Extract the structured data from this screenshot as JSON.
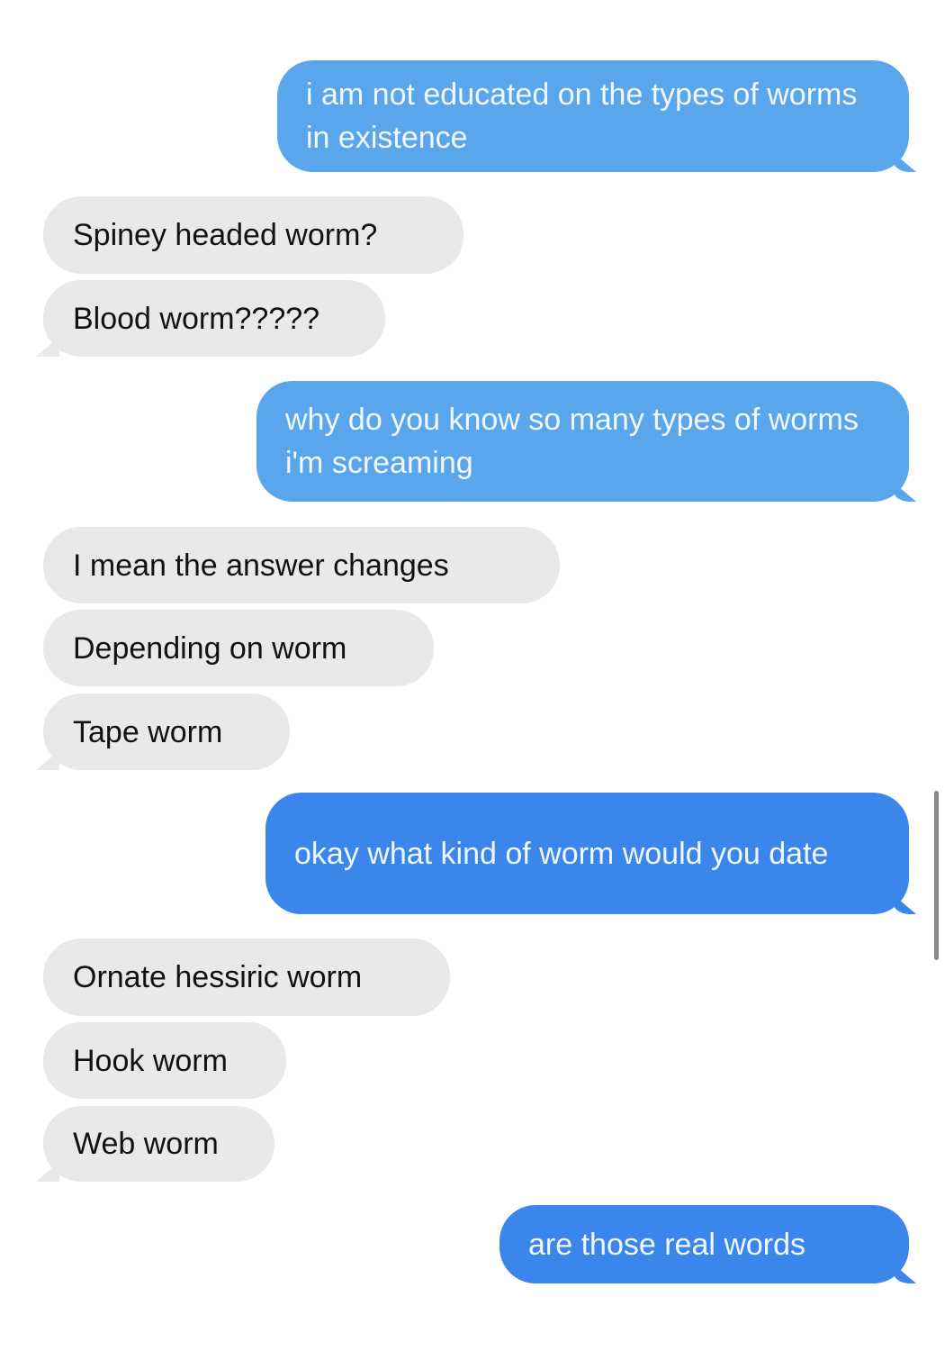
{
  "colors": {
    "sent_light": "#5aa6ec",
    "sent_dark": "#3a86ea",
    "received": "#e9e9eb"
  },
  "messages": [
    {
      "from": "me",
      "text": "i am not educated on the types of worms in existence"
    },
    {
      "from": "them",
      "text": "Spiney headed worm?"
    },
    {
      "from": "them",
      "text": "Blood worm?????"
    },
    {
      "from": "me",
      "text": "why do you know so many types of worms i'm screaming"
    },
    {
      "from": "them",
      "text": "I mean the answer changes"
    },
    {
      "from": "them",
      "text": "Depending on worm"
    },
    {
      "from": "them",
      "text": "Tape worm"
    },
    {
      "from": "me",
      "text": "okay what kind of worm would you date"
    },
    {
      "from": "them",
      "text": "Ornate hessiric worm"
    },
    {
      "from": "them",
      "text": "Hook worm"
    },
    {
      "from": "them",
      "text": "Web worm"
    },
    {
      "from": "me",
      "text": "are those real words"
    }
  ]
}
